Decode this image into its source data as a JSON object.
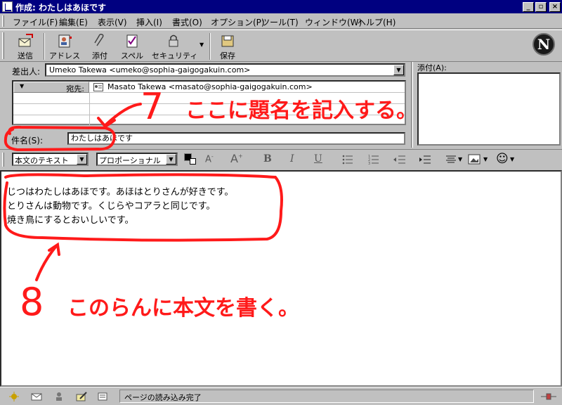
{
  "window": {
    "title": "作成: わたしはあほです",
    "min_glyph": "_",
    "max_glyph": "▫",
    "close_glyph": "×"
  },
  "menu": [
    "ファイル(F)",
    "編集(E)",
    "表示(V)",
    "挿入(I)",
    "書式(O)",
    "オプション(P)",
    "ツール(T)",
    "ウィンドウ(W)",
    "ヘルプ(H)"
  ],
  "toolbar": {
    "send": "送信",
    "address": "アドレス",
    "attach": "添付",
    "spell": "スペル",
    "security": "セキュリティ",
    "save": "保存",
    "logo": "N"
  },
  "header": {
    "from_label": "差出人:",
    "from_value": "Umeko Takewa <umeko@sophia-gaigogakuin.com>",
    "to_type": "宛先:",
    "to_value": "Masato Takewa <masato@sophia-gaigogakuin.com>",
    "subject_label": "件名(S):",
    "subject_value": "わたしはあほです",
    "attach_label": "添付(A):"
  },
  "format": {
    "paragraph_style": "本文のテキスト",
    "font": "プロポーショナル",
    "bold": "B",
    "italic": "I",
    "underline": "U",
    "smiley": "☺"
  },
  "body": [
    "じつはわたしはあほです。あほはとりさんが好きです。",
    "とりさんは動物です。くじらやコアラと同じです。",
    "焼き鳥にするとおいしいです。"
  ],
  "status": {
    "text": "ページの読み込み完了"
  },
  "annotations": {
    "step7_number": "7",
    "step7_text": "ここに題名を記入する。",
    "step8_number": "8",
    "step8_text": "このらんに本文を書く。",
    "color": "#ff1a1a"
  }
}
